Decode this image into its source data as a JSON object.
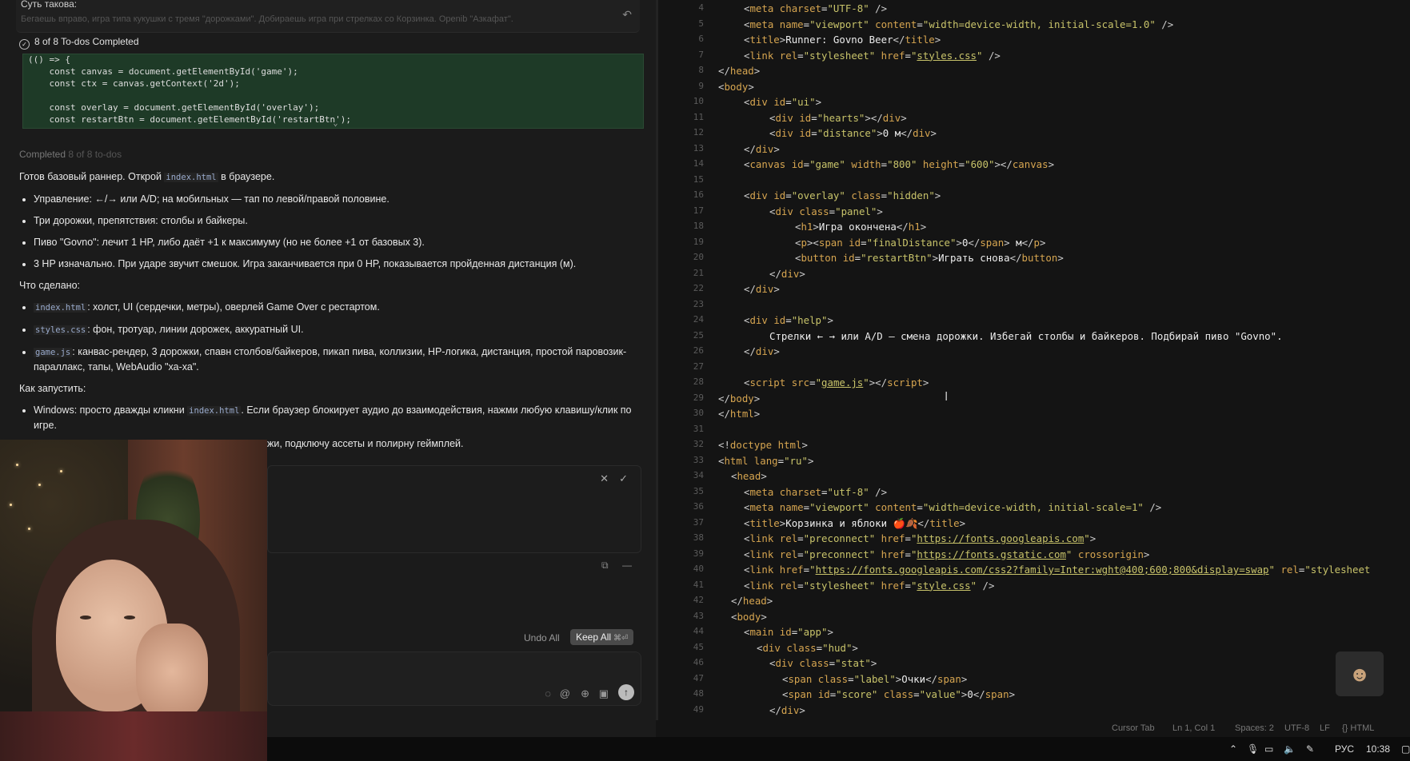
{
  "left_panel": {
    "top_line_title": "Суть такова:",
    "top_line_faded": "Бегаешь вправо, игра типа кукушки с тремя \"дорожками\". Добираешь игра при стрелках со Корзинка. Openib \"Азкафат\".",
    "todo_status": "8 of 8 To-dos Completed",
    "code_lines": [
      "(() => {",
      "    const canvas = document.getElementById('game');",
      "    const ctx = canvas.getContext('2d');",
      "",
      "    const overlay = document.getElementById('overlay');",
      "    const restartBtn = document.getElementById('restartBtn');"
    ],
    "completed_label": "Completed",
    "completed_count": "8 of 8 to-dos",
    "intro_pre": "Готов базовый раннер. Открой ",
    "intro_code": "index.html",
    "intro_post": " в браузере.",
    "bullets_1": [
      "Управление: ←/→ или A/D; на мобильных — тап по левой/правой половине.",
      "Три дорожки, препятствия: столбы и байкеры.",
      "Пиво \"Govno\": лечит 1 HP, либо даёт +1 к максимуму (но не более +1 от базовых 3).",
      "3 HP изначально. При ударе звучит смешок. Игра заканчивается при 0 HP, показывается пройденная дистанция (м)."
    ],
    "done_heading": "Что сделано:",
    "done_items": [
      {
        "code": "index.html",
        "text": ": холст, UI (сердечки, метры), оверлей Game Over с рестартом."
      },
      {
        "code": "styles.css",
        "text": ": фон, тротуар, линии дорожек, аккуратный UI."
      },
      {
        "code": "game.js",
        "text": ": канвас-рендер, 3 дорожки, спавн столбов/байкеров, пикап пива, коллизии, HP-логика, дистанция, простой паровозик-параллакс, тапы, WebAudio \"ха-ха\"."
      }
    ],
    "run_heading": "Как запустить:",
    "run_pre": "Windows: просто дважды кликни ",
    "run_code": "index.html",
    "run_post": ". Если браузер блокирует аудио до взаимодействия, нажми любую клавишу/клик по игре.",
    "trunc_text": "жи, подключу ассеты и полирну геймплей.",
    "undo_all": "Undo All",
    "keep_all": "Keep All",
    "keep_all_shortcut": "⌘⏎"
  },
  "editor": {
    "lines": [
      {
        "n": "4",
        "ind": 2,
        "html": "<span class=tag>&lt;</span><span class=tn>meta</span> <span class=an>charset</span>=<span class=av>\"UTF-8\"</span> <span class=tag>/&gt;</span>"
      },
      {
        "n": "5",
        "ind": 2,
        "html": "<span class=tag>&lt;</span><span class=tn>meta</span> <span class=an>name</span>=<span class=av>\"viewport\"</span> <span class=an>content</span>=<span class=av>\"width=device-width, initial-scale=1.0\"</span> <span class=tag>/&gt;</span>"
      },
      {
        "n": "6",
        "ind": 2,
        "html": "<span class=tag>&lt;</span><span class=tn>title</span><span class=tag>&gt;</span><span class=tx>Runner: Govno Beer</span><span class=tag>&lt;/</span><span class=tn>title</span><span class=tag>&gt;</span>"
      },
      {
        "n": "7",
        "ind": 2,
        "html": "<span class=tag>&lt;</span><span class=tn>link</span> <span class=an>rel</span>=<span class=av>\"stylesheet\"</span> <span class=an>href</span>=<span class=av>\"</span><span class=lk>styles.css</span><span class=av>\"</span> <span class=tag>/&gt;</span>"
      },
      {
        "n": "8",
        "ind": 0,
        "html": "<span class=tag>&lt;/</span><span class=tn>head</span><span class=tag>&gt;</span>"
      },
      {
        "n": "9",
        "ind": 0,
        "html": "<span class=tag>&lt;</span><span class=tn>body</span><span class=tag>&gt;</span>"
      },
      {
        "n": "10",
        "ind": 2,
        "html": "<span class=tag>&lt;</span><span class=tn>div</span> <span class=an>id</span>=<span class=av>\"ui\"</span><span class=tag>&gt;</span>"
      },
      {
        "n": "11",
        "ind": 4,
        "html": "<span class=tag>&lt;</span><span class=tn>div</span> <span class=an>id</span>=<span class=av>\"hearts\"</span><span class=tag>&gt;&lt;/</span><span class=tn>div</span><span class=tag>&gt;</span>"
      },
      {
        "n": "12",
        "ind": 4,
        "html": "<span class=tag>&lt;</span><span class=tn>div</span> <span class=an>id</span>=<span class=av>\"distance\"</span><span class=tag>&gt;</span><span class=tx>0 м</span><span class=tag>&lt;/</span><span class=tn>div</span><span class=tag>&gt;</span>"
      },
      {
        "n": "13",
        "ind": 2,
        "html": "<span class=tag>&lt;/</span><span class=tn>div</span><span class=tag>&gt;</span>"
      },
      {
        "n": "14",
        "ind": 2,
        "html": "<span class=tag>&lt;</span><span class=tn>canvas</span> <span class=an>id</span>=<span class=av>\"game\"</span> <span class=an>width</span>=<span class=av>\"800\"</span> <span class=an>height</span>=<span class=av>\"600\"</span><span class=tag>&gt;&lt;/</span><span class=tn>canvas</span><span class=tag>&gt;</span>"
      },
      {
        "n": "15",
        "ind": 0,
        "html": ""
      },
      {
        "n": "16",
        "ind": 2,
        "html": "<span class=tag>&lt;</span><span class=tn>div</span> <span class=an>id</span>=<span class=av>\"overlay\"</span> <span class=an>class</span>=<span class=av>\"hidden\"</span><span class=tag>&gt;</span>"
      },
      {
        "n": "17",
        "ind": 4,
        "html": "<span class=tag>&lt;</span><span class=tn>div</span> <span class=an>class</span>=<span class=av>\"panel\"</span><span class=tag>&gt;</span>"
      },
      {
        "n": "18",
        "ind": 6,
        "html": "<span class=tag>&lt;</span><span class=tn>h1</span><span class=tag>&gt;</span><span class=tx>Игра окончена</span><span class=tag>&lt;/</span><span class=tn>h1</span><span class=tag>&gt;</span>"
      },
      {
        "n": "19",
        "ind": 6,
        "html": "<span class=tag>&lt;</span><span class=tn>p</span><span class=tag>&gt;&lt;</span><span class=tn>span</span> <span class=an>id</span>=<span class=av>\"finalDistance\"</span><span class=tag>&gt;</span><span class=tx>0</span><span class=tag>&lt;/</span><span class=tn>span</span><span class=tag>&gt;</span><span class=tx> м</span><span class=tag>&lt;/</span><span class=tn>p</span><span class=tag>&gt;</span>"
      },
      {
        "n": "20",
        "ind": 6,
        "html": "<span class=tag>&lt;</span><span class=tn>button</span> <span class=an>id</span>=<span class=av>\"restartBtn\"</span><span class=tag>&gt;</span><span class=tx>Играть снова</span><span class=tag>&lt;/</span><span class=tn>button</span><span class=tag>&gt;</span>"
      },
      {
        "n": "21",
        "ind": 4,
        "html": "<span class=tag>&lt;/</span><span class=tn>div</span><span class=tag>&gt;</span>"
      },
      {
        "n": "22",
        "ind": 2,
        "html": "<span class=tag>&lt;/</span><span class=tn>div</span><span class=tag>&gt;</span>"
      },
      {
        "n": "23",
        "ind": 0,
        "html": ""
      },
      {
        "n": "24",
        "ind": 2,
        "html": "<span class=tag>&lt;</span><span class=tn>div</span> <span class=an>id</span>=<span class=av>\"help\"</span><span class=tag>&gt;</span>"
      },
      {
        "n": "25",
        "ind": 4,
        "html": "<span class=tx>Стрелки ← → или A/D — смена дорожки. Избегай столбы и байкеров. Подбирай пиво \"Govno\".</span>"
      },
      {
        "n": "26",
        "ind": 2,
        "html": "<span class=tag>&lt;/</span><span class=tn>div</span><span class=tag>&gt;</span>"
      },
      {
        "n": "27",
        "ind": 0,
        "html": ""
      },
      {
        "n": "28",
        "ind": 2,
        "html": "<span class=tag>&lt;</span><span class=tn>script</span> <span class=an>src</span>=<span class=av>\"</span><span class=lk>game.js</span><span class=av>\"</span><span class=tag>&gt;&lt;/</span><span class=tn>script</span><span class=tag>&gt;</span>"
      },
      {
        "n": "29",
        "ind": 0,
        "html": "<span class=tag>&lt;/</span><span class=tn>body</span><span class=tag>&gt;</span>"
      },
      {
        "n": "30",
        "ind": 0,
        "html": "<span class=tag>&lt;/</span><span class=tn>html</span><span class=tag>&gt;</span>"
      },
      {
        "n": "31",
        "ind": 0,
        "html": ""
      },
      {
        "n": "32",
        "ind": 0,
        "html": "<span class=tag>&lt;!</span><span class=tn>doctype</span> <span class=an>html</span><span class=tag>&gt;</span>"
      },
      {
        "n": "33",
        "ind": 0,
        "html": "<span class=tag>&lt;</span><span class=tn>html</span> <span class=an>lang</span>=<span class=av>\"ru\"</span><span class=tag>&gt;</span>"
      },
      {
        "n": "34",
        "ind": 1,
        "html": "<span class=tag>&lt;</span><span class=tn>head</span><span class=tag>&gt;</span>"
      },
      {
        "n": "35",
        "ind": 2,
        "html": "<span class=tag>&lt;</span><span class=tn>meta</span> <span class=an>charset</span>=<span class=av>\"utf-8\"</span> <span class=tag>/&gt;</span>"
      },
      {
        "n": "36",
        "ind": 2,
        "html": "<span class=tag>&lt;</span><span class=tn>meta</span> <span class=an>name</span>=<span class=av>\"viewport\"</span> <span class=an>content</span>=<span class=av>\"width=device-width, initial-scale=1\"</span> <span class=tag>/&gt;</span>"
      },
      {
        "n": "37",
        "ind": 2,
        "html": "<span class=tag>&lt;</span><span class=tn>title</span><span class=tag>&gt;</span><span class=tx>Корзинка и яблоки 🍎🍂</span><span class=tag>&lt;/</span><span class=tn>title</span><span class=tag>&gt;</span>"
      },
      {
        "n": "38",
        "ind": 2,
        "html": "<span class=tag>&lt;</span><span class=tn>link</span> <span class=an>rel</span>=<span class=av>\"preconnect\"</span> <span class=an>href</span>=<span class=av>\"</span><span class=lk>https://fonts.googleapis.com</span><span class=av>\"</span><span class=tag>&gt;</span>"
      },
      {
        "n": "39",
        "ind": 2,
        "html": "<span class=tag>&lt;</span><span class=tn>link</span> <span class=an>rel</span>=<span class=av>\"preconnect\"</span> <span class=an>href</span>=<span class=av>\"</span><span class=lk>https://fonts.gstatic.com</span><span class=av>\"</span> <span class=an>crossorigin</span><span class=tag>&gt;</span>"
      },
      {
        "n": "40",
        "ind": 2,
        "html": "<span class=tag>&lt;</span><span class=tn>link</span> <span class=an>href</span>=<span class=av>\"</span><span class=lk>https://fonts.googleapis.com/css2?family=Inter:wght@400;600;800&amp;display=swap</span><span class=av>\"</span> <span class=an>rel</span>=<span class=av>\"stylesheet</span>"
      },
      {
        "n": "41",
        "ind": 2,
        "html": "<span class=tag>&lt;</span><span class=tn>link</span> <span class=an>rel</span>=<span class=av>\"stylesheet\"</span> <span class=an>href</span>=<span class=av>\"</span><span class=lk>style.css</span><span class=av>\"</span> <span class=tag>/&gt;</span>"
      },
      {
        "n": "42",
        "ind": 1,
        "html": "<span class=tag>&lt;/</span><span class=tn>head</span><span class=tag>&gt;</span>"
      },
      {
        "n": "43",
        "ind": 1,
        "html": "<span class=tag>&lt;</span><span class=tn>body</span><span class=tag>&gt;</span>"
      },
      {
        "n": "44",
        "ind": 2,
        "html": "<span class=tag>&lt;</span><span class=tn>main</span> <span class=an>id</span>=<span class=av>\"app\"</span><span class=tag>&gt;</span>"
      },
      {
        "n": "45",
        "ind": 3,
        "html": "<span class=tag>&lt;</span><span class=tn>div</span> <span class=an>class</span>=<span class=av>\"hud\"</span><span class=tag>&gt;</span>"
      },
      {
        "n": "46",
        "ind": 4,
        "html": "<span class=tag>&lt;</span><span class=tn>div</span> <span class=an>class</span>=<span class=av>\"stat\"</span><span class=tag>&gt;</span>"
      },
      {
        "n": "47",
        "ind": 5,
        "html": "<span class=tag>&lt;</span><span class=tn>span</span> <span class=an>class</span>=<span class=av>\"label\"</span><span class=tag>&gt;</span><span class=tx>Очки</span><span class=tag>&lt;/</span><span class=tn>span</span><span class=tag>&gt;</span>"
      },
      {
        "n": "48",
        "ind": 5,
        "html": "<span class=tag>&lt;</span><span class=tn>span</span> <span class=an>id</span>=<span class=av>\"score\"</span> <span class=an>class</span>=<span class=av>\"value\"</span><span class=tag>&gt;</span><span class=tx>0</span><span class=tag>&lt;/</span><span class=tn>span</span><span class=tag>&gt;</span>"
      },
      {
        "n": "49",
        "ind": 4,
        "html": "<span class=tag>&lt;/</span><span class=tn>div</span><span class=tag>&gt;</span>"
      }
    ]
  },
  "status_bar": {
    "cursor_tab": "Cursor Tab",
    "position": "Ln 1, Col 1",
    "spaces": "Spaces: 2",
    "encoding": "UTF-8",
    "eol": "LF",
    "language": "{} HTML"
  },
  "taskbar": {
    "lang": "РУС",
    "time": "10:38"
  },
  "colors": {
    "code_tag_name": "#d6a550",
    "code_attr_value": "#c8c36a",
    "code_block_bg": "#1e3a27",
    "editor_bg": "#141414"
  }
}
